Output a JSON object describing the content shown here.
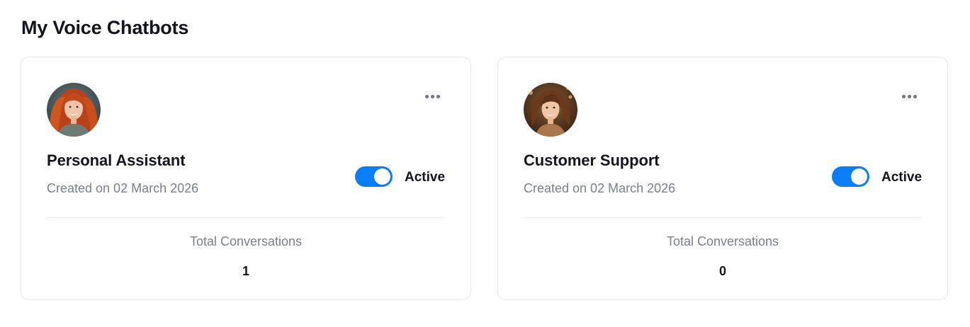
{
  "page": {
    "title": "My Voice Chatbots"
  },
  "bots": [
    {
      "name": "Personal Assistant",
      "created": "Created on 02 March 2026",
      "status": "Active",
      "active": true,
      "stat_label": "Total Conversations",
      "stat_value": "1",
      "avatar": "avatar-red-hair-woman",
      "menu_icon": "more-horizontal-icon"
    },
    {
      "name": "Customer Support",
      "created": "Created on 02 March 2026",
      "status": "Active",
      "active": true,
      "stat_label": "Total Conversations",
      "stat_value": "0",
      "avatar": "avatar-curly-hair-woman",
      "menu_icon": "more-horizontal-icon"
    }
  ],
  "colors": {
    "accent": "#0a7cf5",
    "text_primary": "#14141f",
    "text_muted": "#7a7e8f",
    "border": "#e6e8ee"
  }
}
